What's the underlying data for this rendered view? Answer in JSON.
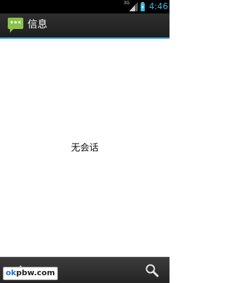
{
  "status_bar": {
    "network_label": "3G",
    "time": "4:46",
    "time_color": "#33b5e5",
    "icons": [
      "signal-icon",
      "battery-charging-icon"
    ]
  },
  "action_bar": {
    "title": "信息",
    "icon": "messaging-app-icon",
    "icon_color": "#8bc34a",
    "accent_color": "#33b5e5"
  },
  "content": {
    "empty_message": "无会话"
  },
  "bottom_bar": {
    "icons": [
      "compose-icon",
      "search-icon"
    ]
  },
  "watermark": {
    "part1": "ok",
    "part2": "pbw.com"
  }
}
